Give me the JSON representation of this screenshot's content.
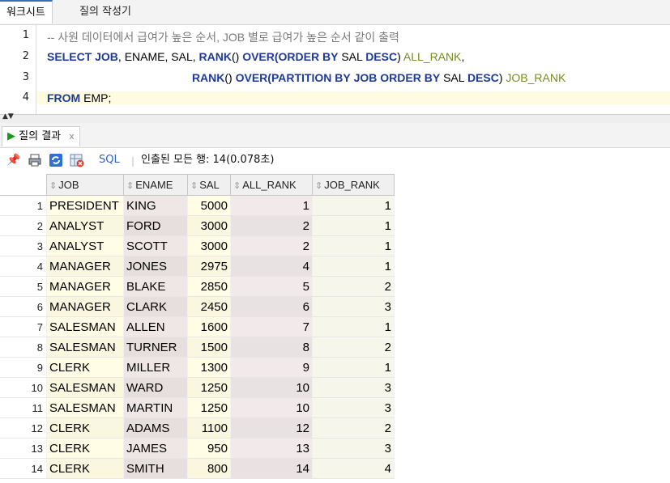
{
  "tabs": {
    "worksheet": "워크시트",
    "query_builder": "질의 작성기"
  },
  "editor": {
    "line_numbers": [
      "1",
      "2",
      "3",
      "4"
    ],
    "comment": "-- 사원 데이터에서 급여가 높은 순서, JOB 별로 급여가 높은 순서 같이 출력",
    "line2": {
      "select": "SELECT",
      "sp1": " ",
      "job": "JOB",
      "cols": ", ENAME, SAL, ",
      "rank": "RANK",
      "paren": "() ",
      "over": "OVER",
      "open": "(",
      "orderby": "ORDER BY",
      "sal": " SAL ",
      "desc": "DESC",
      "close": ") ",
      "alias": "ALL_RANK",
      "comma": ","
    },
    "line3": {
      "indent": "                                              ",
      "rank": "RANK",
      "paren": "() ",
      "over": "OVER",
      "open": "(",
      "partition": "PARTITION BY",
      "sp": " ",
      "job": "JOB",
      "sp2": " ",
      "orderby": "ORDER BY",
      "sal": " SAL ",
      "desc": "DESC",
      "close": ") ",
      "alias": "JOB_RANK"
    },
    "line4": {
      "from": "FROM",
      "table": " EMP;"
    }
  },
  "result": {
    "tab_label": "질의 결과",
    "tab_close": "x",
    "toolbar": {
      "sql_label": "SQL",
      "separator": "|",
      "status": "인출된 모든 행: 14(0.078초)"
    },
    "columns": [
      "JOB",
      "ENAME",
      "SAL",
      "ALL_RANK",
      "JOB_RANK"
    ],
    "rows": [
      [
        "1",
        "PRESIDENT",
        "KING",
        "5000",
        "1",
        "1"
      ],
      [
        "2",
        "ANALYST",
        "FORD",
        "3000",
        "2",
        "1"
      ],
      [
        "3",
        "ANALYST",
        "SCOTT",
        "3000",
        "2",
        "1"
      ],
      [
        "4",
        "MANAGER",
        "JONES",
        "2975",
        "4",
        "1"
      ],
      [
        "5",
        "MANAGER",
        "BLAKE",
        "2850",
        "5",
        "2"
      ],
      [
        "6",
        "MANAGER",
        "CLARK",
        "2450",
        "6",
        "3"
      ],
      [
        "7",
        "SALESMAN",
        "ALLEN",
        "1600",
        "7",
        "1"
      ],
      [
        "8",
        "SALESMAN",
        "TURNER",
        "1500",
        "8",
        "2"
      ],
      [
        "9",
        "CLERK",
        "MILLER",
        "1300",
        "9",
        "1"
      ],
      [
        "10",
        "SALESMAN",
        "WARD",
        "1250",
        "10",
        "3"
      ],
      [
        "11",
        "SALESMAN",
        "MARTIN",
        "1250",
        "10",
        "3"
      ],
      [
        "12",
        "CLERK",
        "ADAMS",
        "1100",
        "12",
        "2"
      ],
      [
        "13",
        "CLERK",
        "JAMES",
        "950",
        "13",
        "3"
      ],
      [
        "14",
        "CLERK",
        "SMITH",
        "800",
        "14",
        "4"
      ]
    ]
  },
  "icons": [
    "pin-icon",
    "print-icon",
    "refresh-icon",
    "delete-icon",
    "sort-icon",
    "play-icon"
  ]
}
